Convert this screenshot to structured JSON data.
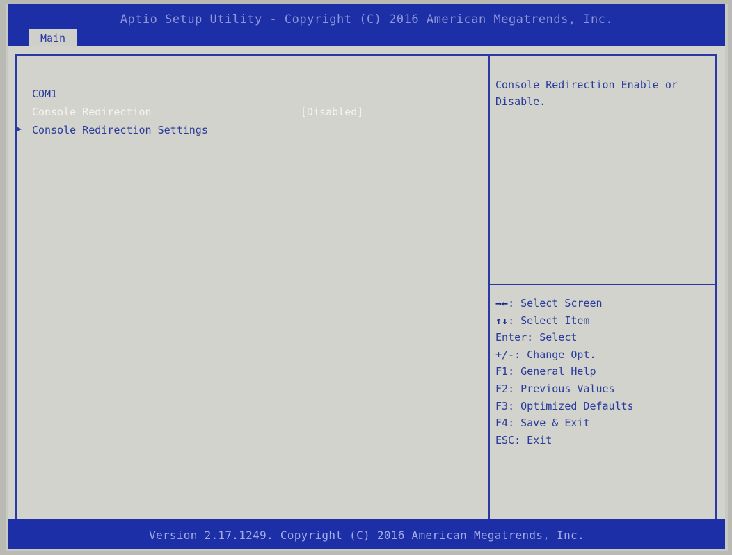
{
  "header": {
    "title": "Aptio Setup Utility - Copyright (C) 2016 American Megatrends, Inc.",
    "tabs": [
      {
        "label": "Main",
        "active": true
      }
    ]
  },
  "main": {
    "section_label": "COM1",
    "items": [
      {
        "label": "Console Redirection",
        "value": "[Disabled]",
        "selected": true
      },
      {
        "label": "Console Redirection Settings",
        "submenu": true
      }
    ]
  },
  "help": {
    "description": "Console Redirection Enable or Disable.",
    "keys": [
      {
        "key": "→←",
        "text": ": Select Screen"
      },
      {
        "key": "↑↓",
        "text": ": Select Item"
      },
      {
        "key": "Enter",
        "text": ": Select"
      },
      {
        "key": "+/-",
        "text": ": Change Opt."
      },
      {
        "key": "F1",
        "text": ": General Help"
      },
      {
        "key": "F2",
        "text": ": Previous Values"
      },
      {
        "key": "F3",
        "text": ": Optimized Defaults"
      },
      {
        "key": "F4",
        "text": ": Save & Exit"
      },
      {
        "key": "ESC",
        "text": ": Exit"
      }
    ]
  },
  "footer": {
    "version": "Version 2.17.1249. Copyright (C) 2016 American Megatrends, Inc."
  },
  "colors": {
    "bar_blue": "#1c2fa6",
    "text_blue": "#2a3b9c",
    "selected_text": "#f4f4f4",
    "screen_bg": "#d2d3cc"
  }
}
